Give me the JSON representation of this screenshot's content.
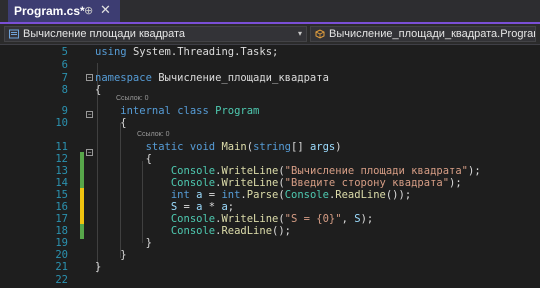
{
  "tab": {
    "title": "Program.cs*",
    "pin": "⊕",
    "close": "✕"
  },
  "navbar": {
    "left_text": "Вычисление площади квадрата",
    "left_chevron": "▾",
    "right_text": "Вычисление_площади_квадрата.Program"
  },
  "refs": {
    "class_refs": "Ссылок: 0",
    "method_refs": "Ссылок: 0"
  },
  "lines": [
    {
      "num": "5",
      "tokens": [
        {
          "t": "using ",
          "c": "kw"
        },
        {
          "t": "System.Threading.Tasks;",
          "c": "ns"
        }
      ]
    },
    {
      "num": "6",
      "tokens": []
    },
    {
      "num": "7",
      "tokens": [
        {
          "t": "namespace ",
          "c": "kw"
        },
        {
          "t": "Вычисление_площади_квадрата",
          "c": "ns"
        }
      ]
    },
    {
      "num": "8",
      "tokens": [
        {
          "t": "{",
          "c": "ns"
        }
      ]
    },
    {
      "num": "9",
      "tokens": [
        {
          "t": "    internal ",
          "c": "kw"
        },
        {
          "t": "class ",
          "c": "kw"
        },
        {
          "t": "Program",
          "c": "cls"
        }
      ]
    },
    {
      "num": "10",
      "tokens": [
        {
          "t": "    {",
          "c": "ns"
        }
      ]
    },
    {
      "num": "11",
      "tokens": [
        {
          "t": "        static ",
          "c": "kw"
        },
        {
          "t": "void ",
          "c": "kw"
        },
        {
          "t": "Main",
          "c": "fn"
        },
        {
          "t": "(",
          "c": "ns"
        },
        {
          "t": "string",
          "c": "kw"
        },
        {
          "t": "[] ",
          "c": "ns"
        },
        {
          "t": "args",
          "c": "var"
        },
        {
          "t": ")",
          "c": "ns"
        }
      ]
    },
    {
      "num": "12",
      "tokens": [
        {
          "t": "        {",
          "c": "ns"
        }
      ]
    },
    {
      "num": "13",
      "tokens": [
        {
          "t": "            Console",
          "c": "cls"
        },
        {
          "t": ".",
          "c": "ns"
        },
        {
          "t": "WriteLine",
          "c": "fn"
        },
        {
          "t": "(",
          "c": "ns"
        },
        {
          "t": "\"Вычисление площади квадрата\"",
          "c": "str"
        },
        {
          "t": ");",
          "c": "ns"
        }
      ]
    },
    {
      "num": "14",
      "tokens": [
        {
          "t": "            Console",
          "c": "cls"
        },
        {
          "t": ".",
          "c": "ns"
        },
        {
          "t": "WriteLine",
          "c": "fn"
        },
        {
          "t": "(",
          "c": "ns"
        },
        {
          "t": "\"Введите сторону квадрата\"",
          "c": "str"
        },
        {
          "t": ");",
          "c": "ns"
        }
      ]
    },
    {
      "num": "15",
      "tokens": [
        {
          "t": "            int ",
          "c": "kw"
        },
        {
          "t": "a",
          "c": "var"
        },
        {
          "t": " = ",
          "c": "ns"
        },
        {
          "t": "int",
          "c": "kw"
        },
        {
          "t": ".",
          "c": "ns"
        },
        {
          "t": "Parse",
          "c": "fn"
        },
        {
          "t": "(",
          "c": "ns"
        },
        {
          "t": "Console",
          "c": "cls"
        },
        {
          "t": ".",
          "c": "ns"
        },
        {
          "t": "ReadLine",
          "c": "fn"
        },
        {
          "t": "());",
          "c": "ns"
        }
      ]
    },
    {
      "num": "16",
      "tokens": [
        {
          "t": "            S",
          "c": "var"
        },
        {
          "t": " = ",
          "c": "ns"
        },
        {
          "t": "a",
          "c": "var"
        },
        {
          "t": " * ",
          "c": "ns"
        },
        {
          "t": "a",
          "c": "var"
        },
        {
          "t": ";",
          "c": "ns"
        }
      ]
    },
    {
      "num": "17",
      "tokens": [
        {
          "t": "            Console",
          "c": "cls"
        },
        {
          "t": ".",
          "c": "ns"
        },
        {
          "t": "WriteLine",
          "c": "fn"
        },
        {
          "t": "(",
          "c": "ns"
        },
        {
          "t": "\"S = {0}\"",
          "c": "str"
        },
        {
          "t": ", ",
          "c": "ns"
        },
        {
          "t": "S",
          "c": "var"
        },
        {
          "t": ");",
          "c": "ns"
        }
      ]
    },
    {
      "num": "18",
      "tokens": [
        {
          "t": "            Console",
          "c": "cls"
        },
        {
          "t": ".",
          "c": "ns"
        },
        {
          "t": "ReadLine",
          "c": "fn"
        },
        {
          "t": "();",
          "c": "ns"
        }
      ]
    },
    {
      "num": "19",
      "tokens": [
        {
          "t": "        }",
          "c": "ns"
        }
      ]
    },
    {
      "num": "20",
      "tokens": [
        {
          "t": "    }",
          "c": "ns"
        }
      ]
    },
    {
      "num": "21",
      "tokens": [
        {
          "t": "}",
          "c": "ns"
        }
      ]
    },
    {
      "num": "22",
      "tokens": []
    }
  ],
  "colors": {
    "editor_bg": "#1e1e1e",
    "line_number": "#2b91af",
    "keyword": "#569cd6",
    "type": "#4ec9b0",
    "method": "#dcdcaa",
    "string": "#d69d85",
    "variable": "#9cdcfe",
    "change_saved": "#57a64a",
    "change_unsaved": "#efc30f"
  },
  "change_markers": {
    "saved_lines": [
      "12",
      "13",
      "14",
      "18"
    ],
    "unsaved_lines": [
      "15",
      "16",
      "17"
    ]
  }
}
